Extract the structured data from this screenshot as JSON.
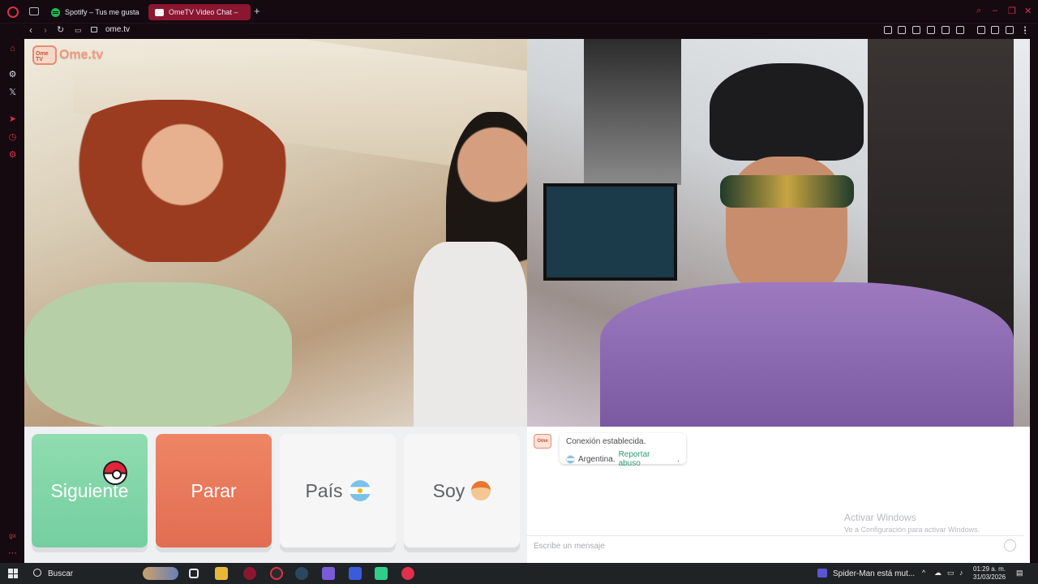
{
  "browser": {
    "tabs": [
      {
        "label": "Spotify – Tus me gusta"
      },
      {
        "label": "OmeTV Video Chat –"
      }
    ],
    "url": "ome.tv"
  },
  "site": {
    "logo_text": "Ome.tv",
    "logo_badge": "Ome TV"
  },
  "controls": {
    "next_label": "Siguiente",
    "stop_label": "Parar",
    "country_label": "País",
    "gender_label": "Soy"
  },
  "chat": {
    "status": "Conexión establecida.",
    "country": "Argentina.",
    "report_link": "Reportar abuso",
    "report_suffix": ".",
    "input_placeholder": "Escribe un mensaje",
    "watermark_title": "Activar Windows",
    "watermark_sub": "Ve a Configuración para activar Windows."
  },
  "taskbar": {
    "search_label": "Buscar",
    "notification": "Spider-Man está mut...",
    "time": "01:29 a. m.",
    "date": "31/03/2026"
  },
  "colors": {
    "accent_browser": "#e0304c",
    "next_button": "#7fd6a7",
    "stop_button": "#e8795a",
    "link": "#2a9d79"
  }
}
